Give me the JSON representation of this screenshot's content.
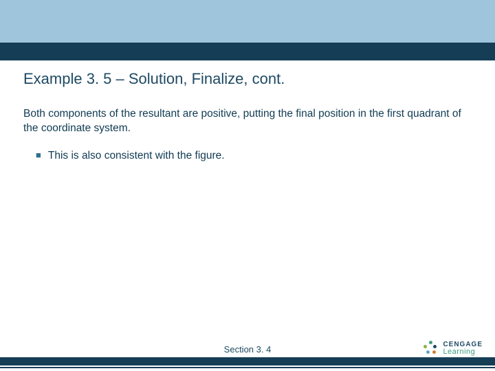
{
  "title": "Example 3. 5 – Solution, Finalize, cont.",
  "body": "Both components of the resultant are positive, putting the final position in the first quadrant of the coordinate system.",
  "bullet": "This is also consistent with the figure.",
  "section": "Section 3. 4",
  "logo": {
    "top": "CENGAGE",
    "bottom": "Learning"
  }
}
